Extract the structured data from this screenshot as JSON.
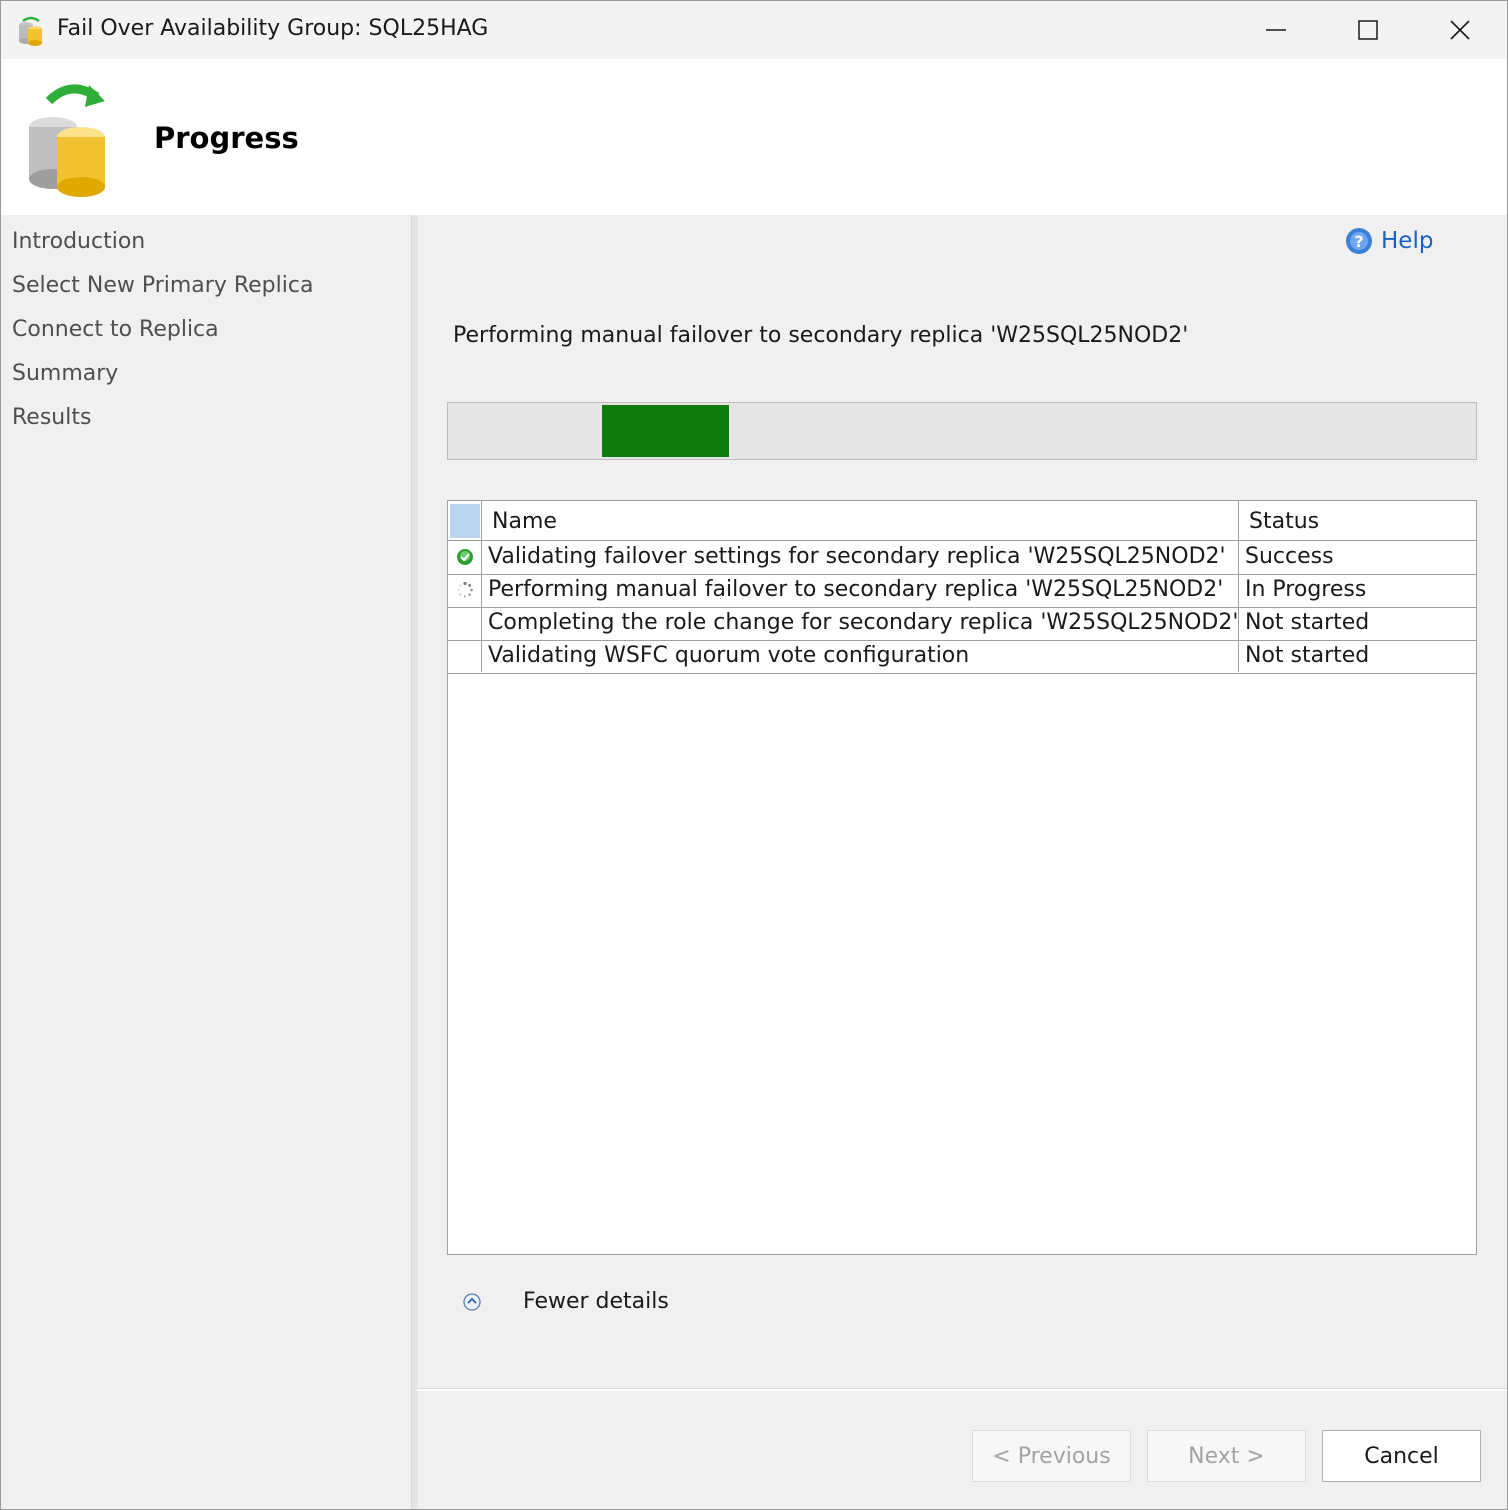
{
  "window": {
    "title": "Fail Over Availability Group: SQL25HAG",
    "minimize_glyph": "—",
    "maximize_glyph": "☐",
    "close_glyph": "✕"
  },
  "header": {
    "title": "Progress",
    "icon": "database-failover-icon"
  },
  "nav": {
    "items": [
      {
        "label": "Introduction"
      },
      {
        "label": "Select New Primary Replica"
      },
      {
        "label": "Connect to Replica"
      },
      {
        "label": "Summary"
      },
      {
        "label": "Results"
      }
    ]
  },
  "help": {
    "label": "Help",
    "icon": "help-icon"
  },
  "status_message": "Performing manual failover to secondary replica 'W25SQL25NOD2'",
  "progress": {
    "value_percent": 12,
    "color": "#0f7b0f"
  },
  "grid": {
    "columns": {
      "name": "Name",
      "status": "Status"
    },
    "rows": [
      {
        "icon": "success-icon",
        "name": "Validating failover settings for secondary replica 'W25SQL25NOD2'",
        "status": "Success"
      },
      {
        "icon": "spinner-icon",
        "name": "Performing manual failover to secondary replica 'W25SQL25NOD2'",
        "status": "In Progress"
      },
      {
        "icon": "",
        "name": "Completing the role change for secondary replica 'W25SQL25NOD2'",
        "status": "Not started"
      },
      {
        "icon": "",
        "name": "Validating WSFC quorum vote configuration",
        "status": "Not started"
      }
    ]
  },
  "details": {
    "label": "Fewer details",
    "icon": "collapse-icon"
  },
  "buttons": {
    "previous": "< Previous",
    "next": "Next >",
    "cancel": "Cancel"
  }
}
